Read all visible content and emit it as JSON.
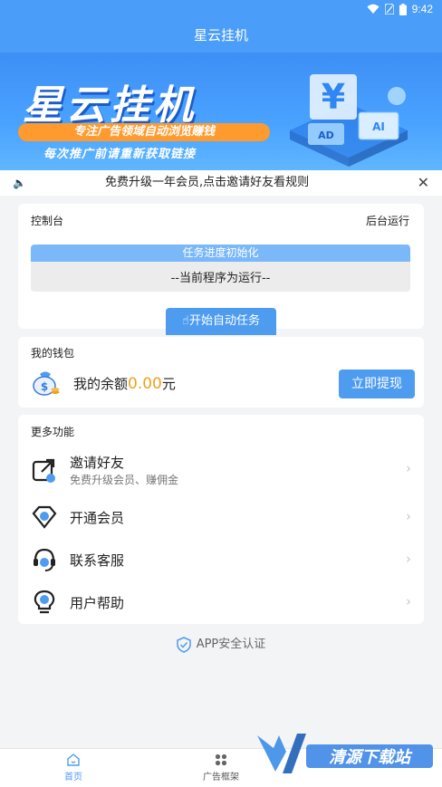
{
  "status_bar": {
    "time": "9:42",
    "battery_level_pct": 90
  },
  "header": {
    "title": "星云挂机"
  },
  "banner": {
    "title": "星云挂机",
    "tagline": "专注广告领域自动浏览赚钱",
    "subtitle": "每次推广前请重新获取链接",
    "art_labels": {
      "ad": "AD",
      "ai": "AI"
    }
  },
  "notice": {
    "text": "免费升级一年会员,点击邀请好友看规则"
  },
  "console": {
    "title": "控制台",
    "mode": "后台运行",
    "progress_label": "任务进度初始化",
    "progress_fraction": 1.0,
    "status_text": "--当前程序为运行--",
    "start_button": "开始自动任务"
  },
  "wallet": {
    "title": "我的钱包",
    "balance_prefix": "我的余额",
    "balance_value": "0.00",
    "balance_unit": "元",
    "withdraw_button": "立即提现"
  },
  "features": {
    "title": "更多功能",
    "items": [
      {
        "label": "邀请好友",
        "sub": "免费升级会员、赚佣金",
        "icon": "share-icon"
      },
      {
        "label": "开通会员",
        "sub": "",
        "icon": "diamond-icon"
      },
      {
        "label": "联系客服",
        "sub": "",
        "icon": "headset-icon"
      },
      {
        "label": "用户帮助",
        "sub": "",
        "icon": "lightbulb-icon"
      }
    ]
  },
  "security": {
    "text": "APP安全认证"
  },
  "tabbar": {
    "tabs": [
      {
        "label": "首页",
        "icon": "home-icon",
        "active": true
      },
      {
        "label": "广告框架",
        "icon": "grid-icon",
        "active": false
      }
    ]
  },
  "watermark": {
    "text": "清源下载站",
    "url": "www.fotmsem.com"
  },
  "colors": {
    "primary": "#4e9cf0",
    "accent": "#f0a11b",
    "banner_pill": "#ff9a2e"
  }
}
